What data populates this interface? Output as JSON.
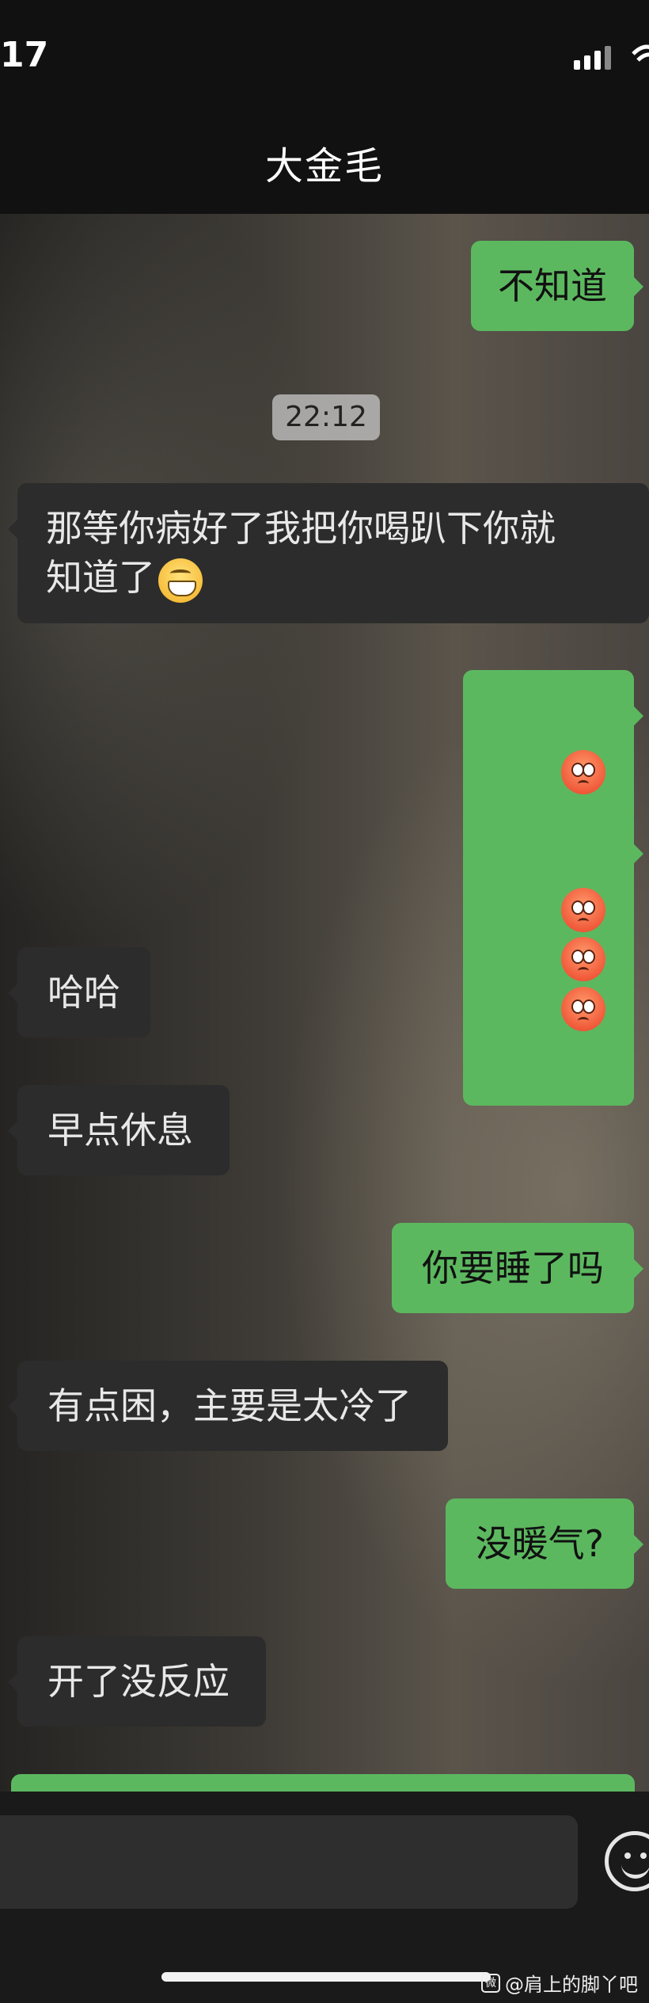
{
  "status_bar": {
    "time": "17"
  },
  "header": {
    "contact_name": "大金毛"
  },
  "timestamp": "22:12",
  "messages": [
    {
      "side": "out",
      "text": "不知道"
    },
    {
      "side": "in",
      "text": "那等你病好了我把你喝趴下你就\n知道了",
      "emoji": "grin-icon"
    },
    {
      "side": "out",
      "emoji": "flushed-face-icon",
      "count": 1
    },
    {
      "side": "out",
      "emoji": "flushed-face-icon",
      "count": 3
    },
    {
      "side": "in",
      "text": "哈哈"
    },
    {
      "side": "in",
      "text": "早点休息"
    },
    {
      "side": "out",
      "text": "你要睡了吗"
    },
    {
      "side": "in",
      "text": "有点困，主要是太冷了"
    },
    {
      "side": "out",
      "text": "没暖气?"
    },
    {
      "side": "in",
      "text": "开了没反应"
    }
  ],
  "watermark": {
    "text": "@肩上的脚丫吧",
    "logo": "微"
  },
  "colors": {
    "outgoing": "#5cb85f",
    "incoming": "#2c2c2c",
    "bar": "#111111"
  }
}
